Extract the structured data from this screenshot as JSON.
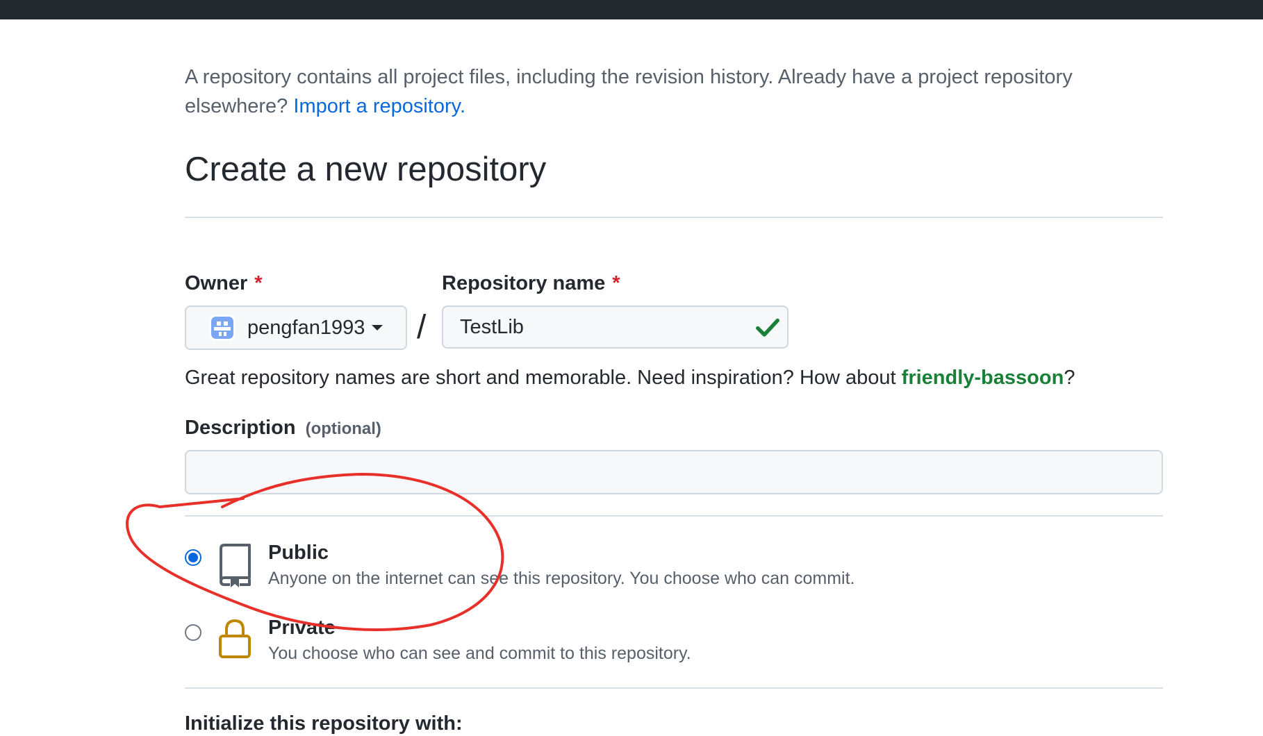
{
  "intro": {
    "text": "A repository contains all project files, including the revision history. Already have a project repository elsewhere?",
    "import_link": "Import a repository."
  },
  "page_title": "Create a new repository",
  "owner": {
    "label": "Owner",
    "required_mark": "*",
    "selected": "pengfan1993"
  },
  "repo_name": {
    "label": "Repository name",
    "required_mark": "*",
    "value": "TestLib",
    "valid": true
  },
  "name_hint": {
    "text": "Great repository names are short and memorable. Need inspiration? How about",
    "suggestion": "friendly-bassoon",
    "suffix": "?"
  },
  "description": {
    "label": "Description",
    "optional": "(optional)",
    "value": ""
  },
  "visibility": {
    "selected": "public",
    "options": [
      {
        "title": "Public",
        "description": "Anyone on the internet can see this repository. You choose who can commit.",
        "icon": "repo-icon"
      },
      {
        "title": "Private",
        "description": "You choose who can see and commit to this repository.",
        "icon": "lock-icon"
      }
    ]
  },
  "initialize_title": "Initialize this repository with:",
  "colors": {
    "link": "#0969da",
    "success": "#1a7f37",
    "required": "#cf222e",
    "annotation": "#e8302a",
    "lock": "#bf8700"
  }
}
